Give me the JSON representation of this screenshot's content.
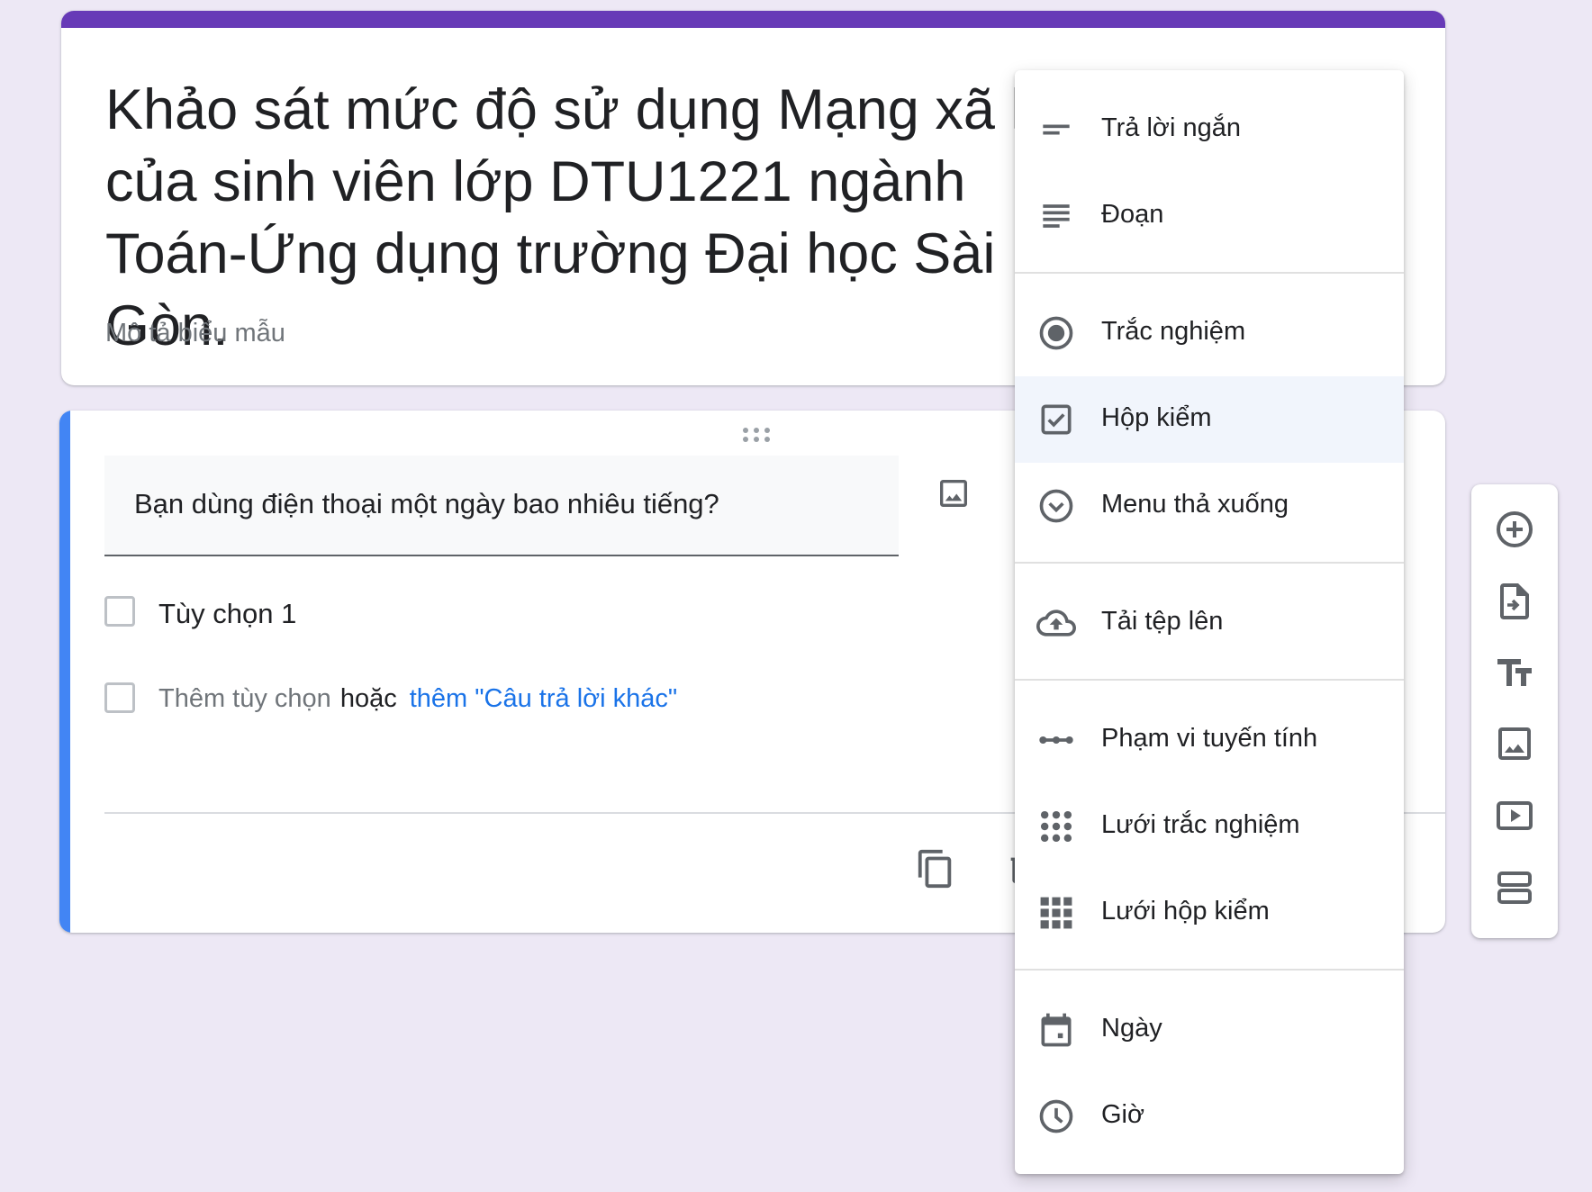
{
  "form": {
    "title": "Khảo sát mức độ sử dụng Mạng xã hội của sinh viên lớp DTU1221 ngành Toán-Ứng dụng trường Đại học Sài Gòn.",
    "description_placeholder": "Mô tả biểu mẫu"
  },
  "question": {
    "text": "Bạn dùng điện thoại một ngày bao nhiêu tiếng?",
    "options": [
      "Tùy chọn 1"
    ],
    "add_option_label": "Thêm tùy chọn",
    "or_label": "hoặc",
    "add_other_label": "thêm \"Câu trả lời khác\""
  },
  "type_menu": {
    "items": [
      {
        "label": "Trả lời ngắn",
        "icon": "short-answer-icon"
      },
      {
        "label": "Đoạn",
        "icon": "paragraph-icon"
      },
      {
        "label": "Trắc nghiệm",
        "icon": "radio-button-icon"
      },
      {
        "label": "Hộp kiểm",
        "icon": "checkbox-icon",
        "selected": true
      },
      {
        "label": "Menu thả xuống",
        "icon": "dropdown-icon"
      },
      {
        "label": "Tải tệp lên",
        "icon": "cloud-upload-icon"
      },
      {
        "label": "Phạm vi tuyến tính",
        "icon": "linear-scale-icon"
      },
      {
        "label": "Lưới trắc nghiệm",
        "icon": "multiple-choice-grid-icon"
      },
      {
        "label": "Lưới hộp kiểm",
        "icon": "checkbox-grid-icon"
      },
      {
        "label": "Ngày",
        "icon": "calendar-icon"
      },
      {
        "label": "Giờ",
        "icon": "clock-icon"
      }
    ]
  },
  "side_toolbar": {
    "icons": [
      "add-question-icon",
      "import-questions-icon",
      "add-title-icon",
      "add-image-icon",
      "add-video-icon",
      "add-section-icon"
    ]
  },
  "colors": {
    "theme": "#673ab7",
    "question_accent": "#4285f4",
    "link": "#1a73e8",
    "background": "#ede8f5"
  }
}
